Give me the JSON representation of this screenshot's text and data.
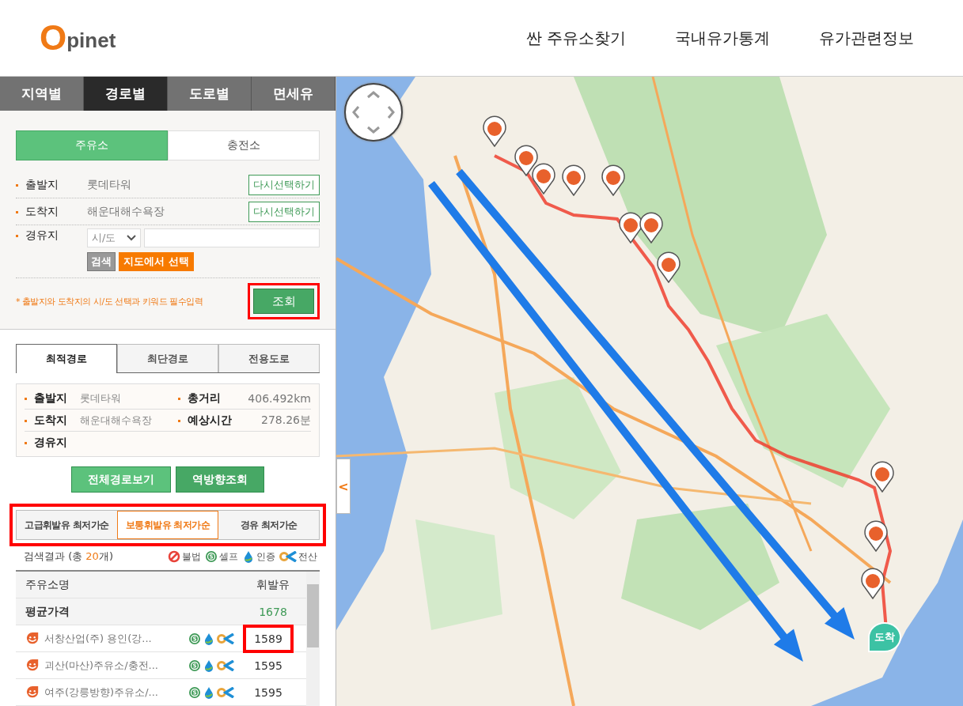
{
  "header": {
    "logo_mark": "O",
    "logo_text": "pinet",
    "nav": [
      {
        "label": "싼 주유소찾기"
      },
      {
        "label": "국내유가통계"
      },
      {
        "label": "유가관련정보"
      }
    ]
  },
  "region_tabs": [
    {
      "label": "지역별",
      "selected": false
    },
    {
      "label": "경로별",
      "selected": true
    },
    {
      "label": "도로별",
      "selected": false
    },
    {
      "label": "면세유",
      "selected": false
    }
  ],
  "station_type_tabs": [
    {
      "label": "주유소",
      "selected": true
    },
    {
      "label": "충전소",
      "selected": false
    }
  ],
  "route_form": {
    "origin": {
      "label": "출발지",
      "value": "롯데타워",
      "button": "다시선택하기"
    },
    "destination": {
      "label": "도착지",
      "value": "해운대해수욕장",
      "button": "다시선택하기"
    },
    "waypoint": {
      "label": "경유지",
      "select_placeholder": "시/도",
      "search_button": "검색",
      "map_button": "지도에서 선택"
    },
    "notice": "* 출발지와 도착지의 시/도 선택과 키워드 필수입력",
    "submit": "조회",
    "submit_highlighted": true
  },
  "route_tabs": [
    {
      "label": "최적경로",
      "selected": true
    },
    {
      "label": "최단경로",
      "selected": false
    },
    {
      "label": "전용도로",
      "selected": false
    }
  ],
  "summary": {
    "origin": {
      "label": "출발지",
      "value": "롯데타워"
    },
    "distance": {
      "label": "총거리",
      "value": "406.492km"
    },
    "destination": {
      "label": "도착지",
      "value": "해운대해수욕장"
    },
    "time": {
      "label": "예상시간",
      "value": "278.26분"
    },
    "waypoint": {
      "label": "경유지"
    }
  },
  "action_buttons": [
    {
      "label": "전체경로보기",
      "kind": "light"
    },
    {
      "label": "역방향조회",
      "kind": "dark"
    }
  ],
  "fuel_tabs": {
    "highlighted": true,
    "items": [
      {
        "label": "고급휘발유 최저가순",
        "selected": false
      },
      {
        "label": "보통휘발유 최저가순",
        "selected": true
      },
      {
        "label": "경유 최저가순",
        "selected": false
      }
    ]
  },
  "results": {
    "prefix": "검색결과 (총 ",
    "count": "20",
    "suffix": "개)",
    "legend": [
      {
        "kind": "illegal",
        "label": "불법"
      },
      {
        "kind": "self",
        "label": "셀프"
      },
      {
        "kind": "certified",
        "label": "인증"
      },
      {
        "kind": "computerized",
        "label": "전산"
      }
    ]
  },
  "table": {
    "columns": [
      "주유소명",
      "휘발유"
    ],
    "average": {
      "label": "평균가격",
      "value": "1678"
    },
    "rows": [
      {
        "name": "서창산업(주) 용인(강...",
        "price": "1589",
        "self": true,
        "certified": true,
        "computerized": true,
        "highlighted": true
      },
      {
        "name": "괴산(마산)주유소/충전...",
        "price": "1595",
        "self": true,
        "certified": true,
        "computerized": true,
        "highlighted": false
      },
      {
        "name": "여주(강릉방향)주유소/...",
        "price": "1595",
        "self": true,
        "certified": true,
        "computerized": true,
        "highlighted": false
      }
    ]
  },
  "map": {
    "destination_label": "도착",
    "collapse_label": "<"
  }
}
